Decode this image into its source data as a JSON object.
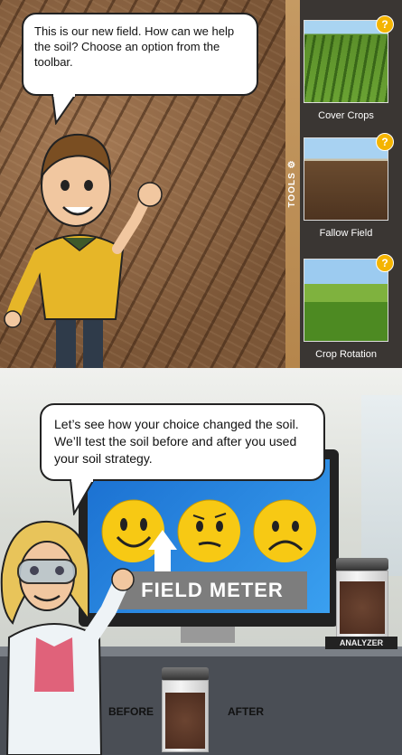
{
  "top_scene": {
    "speech": "This is our new field. How can we help the soil? Choose an option from the toolbar.",
    "tools_label": "TOOLS",
    "tools": [
      {
        "label": "Cover Crops",
        "badge": "?"
      },
      {
        "label": "Fallow Field",
        "badge": "?"
      },
      {
        "label": "Crop Rotation",
        "badge": "?"
      }
    ]
  },
  "bottom_scene": {
    "speech": "Let’s see how your choice changed the soil. We’ll test the soil before and after you used your soil strategy.",
    "meter_label": "FIELD METER",
    "analyzer_label": "ANALYZER",
    "before_label": "BEFORE",
    "after_label": "AFTER",
    "selected_face": "happy"
  },
  "colors": {
    "accent_yellow": "#f7c914",
    "screen_blue": "#2a86df",
    "toolbar_bg": "#3a3633",
    "badge": "#f4b400"
  }
}
